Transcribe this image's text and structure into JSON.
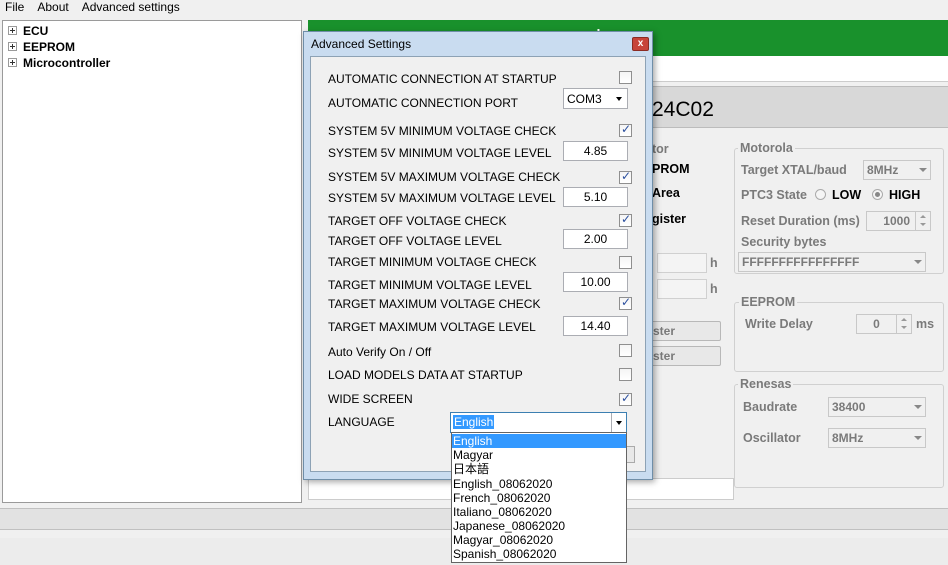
{
  "menu": [
    "File",
    "About",
    "Advanced settings"
  ],
  "tree": [
    "ECU",
    "EEPROM",
    "Microcontroller"
  ],
  "main": {
    "header_title": "by",
    "device": "24C02",
    "partial_left": {
      "r1": "tor",
      "r2": "PROM",
      "r3": "Area",
      "r4": "gister",
      "h1": "h",
      "h2": "h",
      "btn1": "ster",
      "btn2": "ster"
    },
    "motorola": {
      "title": "Motorola",
      "xtal_label": "Target XTAL/baud",
      "xtal_value": "8MHz",
      "ptc3_label": "PTC3 State",
      "low": "LOW",
      "high": "HIGH",
      "reset_label": "Reset Duration (ms)",
      "reset_value": "1000",
      "security_label": "Security bytes",
      "security_value": "FFFFFFFFFFFFFFFF"
    },
    "eeprom": {
      "title": "EEPROM",
      "write_delay_label": "Write Delay",
      "write_delay_value": "0",
      "unit": "ms"
    },
    "renesas": {
      "title": "Renesas",
      "baud_label": "Baudrate",
      "baud_value": "38400",
      "osc_label": "Oscillator",
      "osc_value": "8MHz"
    }
  },
  "dialog": {
    "title": "Advanced Settings",
    "close": "x",
    "rows": {
      "auto_conn": "AUTOMATIC CONNECTION AT STARTUP",
      "auto_port": "AUTOMATIC CONNECTION PORT",
      "port_value": "COM3",
      "min5_check": "SYSTEM 5V MINIMUM VOLTAGE CHECK",
      "min5_level": "SYSTEM 5V MINIMUM VOLTAGE LEVEL",
      "min5_value": "4.85",
      "max5_check": "SYSTEM 5V MAXIMUM VOLTAGE CHECK",
      "max5_level": "SYSTEM 5V MAXIMUM VOLTAGE LEVEL",
      "max5_value": "5.10",
      "off_check": "TARGET OFF VOLTAGE CHECK",
      "off_level": "TARGET OFF VOLTAGE LEVEL",
      "off_value": "2.00",
      "tmin_check": "TARGET MINIMUM VOLTAGE CHECK",
      "tmin_level": "TARGET MINIMUM VOLTAGE LEVEL",
      "tmin_value": "10.00",
      "tmax_check": "TARGET MAXIMUM VOLTAGE CHECK",
      "tmax_level": "TARGET MAXIMUM VOLTAGE LEVEL",
      "tmax_value": "14.40",
      "auto_verify": "Auto Verify On / Off",
      "load_models": "LOAD MODELS DATA AT STARTUP",
      "wide_screen": "WIDE SCREEN",
      "language": "LANGUAGE",
      "language_value": "English"
    },
    "language_options": [
      "English",
      "Magyar",
      "日本語",
      "English_08062020",
      "French_08062020",
      "Italiano_08062020",
      "Japanese_08062020",
      "Magyar_08062020",
      "Spanish_08062020"
    ]
  }
}
